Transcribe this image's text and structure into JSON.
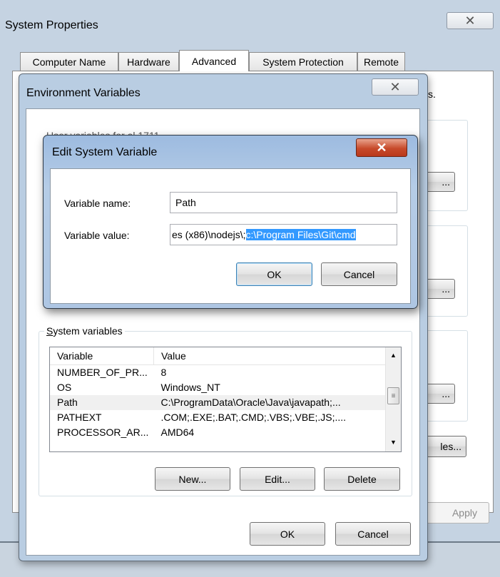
{
  "system_properties": {
    "title": "System Properties",
    "tabs": [
      {
        "label": "Computer Name"
      },
      {
        "label": "Hardware"
      },
      {
        "label": "Advanced"
      },
      {
        "label": "System Protection"
      },
      {
        "label": "Remote"
      }
    ],
    "hint_text": "s.",
    "apply_label": "Apply",
    "settings_btn_partial": "...",
    "env_btn_partial": "les..."
  },
  "env_vars": {
    "title": "Environment Variables",
    "user_vars_label": "User variables for al 1711",
    "system_vars_label": "System variables",
    "col_variable": "Variable",
    "col_value": "Value",
    "rows": [
      {
        "name": "NUMBER_OF_PR...",
        "value": "8"
      },
      {
        "name": "OS",
        "value": "Windows_NT"
      },
      {
        "name": "Path",
        "value": "C:\\ProgramData\\Oracle\\Java\\javapath;..."
      },
      {
        "name": "PATHEXT",
        "value": ".COM;.EXE;.BAT;.CMD;.VBS;.VBE;.JS;...."
      },
      {
        "name": "PROCESSOR_AR...",
        "value": "AMD64"
      }
    ],
    "new_label": "New...",
    "edit_label": "Edit...",
    "delete_label": "Delete",
    "ok_label": "OK",
    "cancel_label": "Cancel"
  },
  "edit_dialog": {
    "title": "Edit System Variable",
    "name_label": "Variable name:",
    "value_label": "Variable value:",
    "name_value": "Path",
    "value_unselected": "es (x86)\\nodejs\\;",
    "value_selected": "c:\\Program Files\\Git\\cmd",
    "ok_label": "OK",
    "cancel_label": "Cancel"
  }
}
